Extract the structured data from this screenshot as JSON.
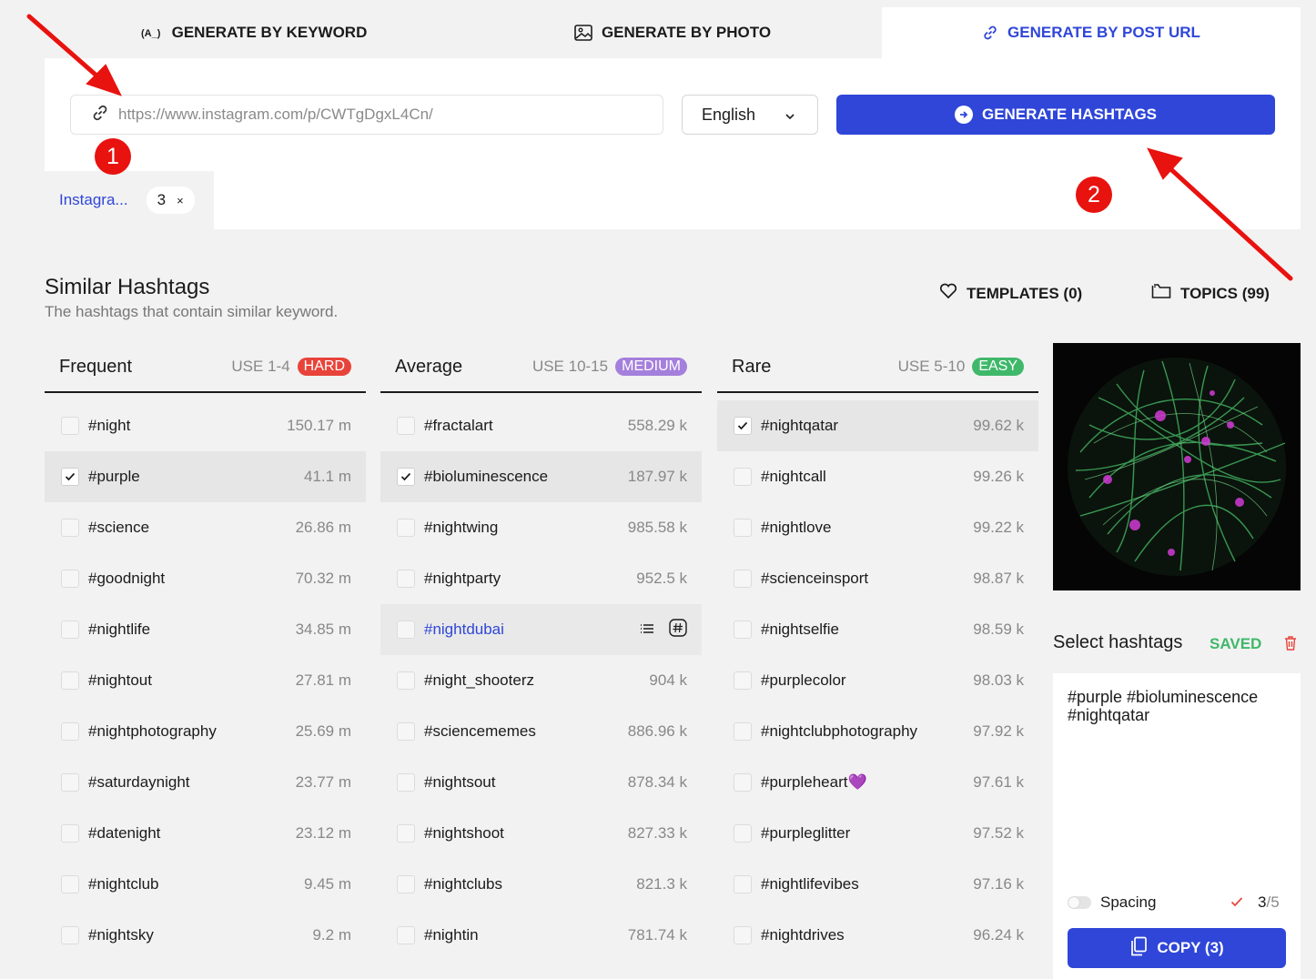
{
  "tabs": [
    {
      "label": "GENERATE BY KEYWORD",
      "icon": "keyword-icon"
    },
    {
      "label": "GENERATE BY PHOTO",
      "icon": "image-icon"
    },
    {
      "label": "GENERATE BY POST URL",
      "icon": "link-icon"
    }
  ],
  "url_input": {
    "value": "https://www.instagram.com/p/CWTgDgxL4Cn/"
  },
  "language": {
    "selected": "English"
  },
  "generate_button": {
    "label": "GENERATE HASHTAGS"
  },
  "source_chip": {
    "name": "Instagra...",
    "count": "3",
    "close": "×"
  },
  "markers": {
    "one": "1",
    "two": "2"
  },
  "similar": {
    "title": "Similar Hashtags",
    "subtitle": "The hashtags that contain similar keyword.",
    "templates_label": "TEMPLATES (0)",
    "topics_label": "TOPICS (99)"
  },
  "columns": [
    {
      "name": "Frequent",
      "use": "USE 1-4",
      "level": "HARD",
      "level_color": "#e8433a",
      "rows": [
        {
          "tag": "#night",
          "count": "150.17 m",
          "checked": false
        },
        {
          "tag": "#purple",
          "count": "41.1 m",
          "checked": true
        },
        {
          "tag": "#science",
          "count": "26.86 m",
          "checked": false
        },
        {
          "tag": "#goodnight",
          "count": "70.32 m",
          "checked": false
        },
        {
          "tag": "#nightlife",
          "count": "34.85 m",
          "checked": false
        },
        {
          "tag": "#nightout",
          "count": "27.81 m",
          "checked": false
        },
        {
          "tag": "#nightphotography",
          "count": "25.69 m",
          "checked": false
        },
        {
          "tag": "#saturdaynight",
          "count": "23.77 m",
          "checked": false
        },
        {
          "tag": "#datenight",
          "count": "23.12 m",
          "checked": false
        },
        {
          "tag": "#nightclub",
          "count": "9.45 m",
          "checked": false
        },
        {
          "tag": "#nightsky",
          "count": "9.2 m",
          "checked": false
        }
      ]
    },
    {
      "name": "Average",
      "use": "USE 10-15",
      "level": "MEDIUM",
      "level_color": "#a47fdc",
      "rows": [
        {
          "tag": "#fractalart",
          "count": "558.29 k",
          "checked": false
        },
        {
          "tag": "#bioluminescence",
          "count": "187.97 k",
          "checked": true
        },
        {
          "tag": "#nightwing",
          "count": "985.58 k",
          "checked": false
        },
        {
          "tag": "#nightparty",
          "count": "952.5 k",
          "checked": false
        },
        {
          "tag": "#nightdubai",
          "count": "",
          "checked": false,
          "hover": true
        },
        {
          "tag": "#night_shooterz",
          "count": "904 k",
          "checked": false
        },
        {
          "tag": "#sciencememes",
          "count": "886.96 k",
          "checked": false
        },
        {
          "tag": "#nightsout",
          "count": "878.34 k",
          "checked": false
        },
        {
          "tag": "#nightshoot",
          "count": "827.33 k",
          "checked": false
        },
        {
          "tag": "#nightclubs",
          "count": "821.3 k",
          "checked": false
        },
        {
          "tag": "#nightin",
          "count": "781.74 k",
          "checked": false
        }
      ]
    },
    {
      "name": "Rare",
      "use": "USE 5-10",
      "level": "EASY",
      "level_color": "#3fb86a",
      "rows": [
        {
          "tag": "#nightqatar",
          "count": "99.62 k",
          "checked": true
        },
        {
          "tag": "#nightcall",
          "count": "99.26 k",
          "checked": false
        },
        {
          "tag": "#nightlove",
          "count": "99.22 k",
          "checked": false
        },
        {
          "tag": "#scienceinsport",
          "count": "98.87 k",
          "checked": false
        },
        {
          "tag": "#nightselfie",
          "count": "98.59 k",
          "checked": false
        },
        {
          "tag": "#purplecolor",
          "count": "98.03 k",
          "checked": false
        },
        {
          "tag": "#nightclubphotography",
          "count": "97.92 k",
          "checked": false
        },
        {
          "tag": "#purpleheart💜",
          "count": "97.61 k",
          "checked": false
        },
        {
          "tag": "#purpleglitter",
          "count": "97.52 k",
          "checked": false
        },
        {
          "tag": "#nightlifevibes",
          "count": "97.16 k",
          "checked": false
        },
        {
          "tag": "#nightdrives",
          "count": "96.24 k",
          "checked": false
        }
      ]
    }
  ],
  "selected": {
    "title": "Select hashtags",
    "saved": "SAVED",
    "text": "#purple #bioluminescence #nightqatar",
    "spacing_label": "Spacing",
    "count": "3",
    "max": "/5",
    "copy_label": "COPY (3)"
  },
  "colors": {
    "accent": "#2f46d8",
    "marker": "#e8120f",
    "saved": "#3fb86a"
  }
}
